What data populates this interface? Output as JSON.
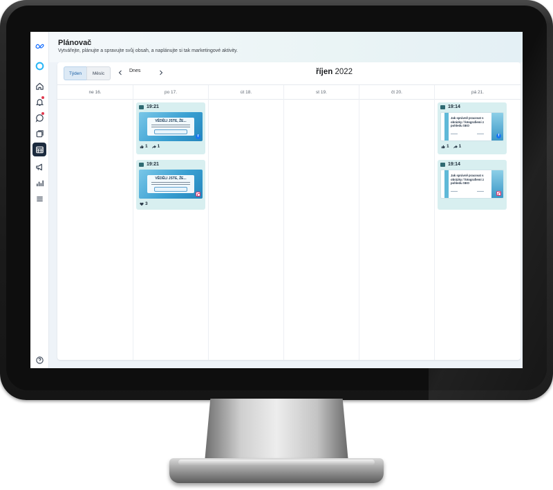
{
  "app": {
    "title": "Plánovač",
    "subtitle": "Vytvářejte, plánujte a spravujte svůj obsah, a naplánujte si tak marketingové aktivity."
  },
  "nav": {
    "items": [
      {
        "icon": "meta-logo-icon"
      },
      {
        "icon": "meta-business-suite-icon"
      },
      {
        "icon": "home-icon"
      },
      {
        "icon": "notifications-bell-icon"
      },
      {
        "icon": "inbox-icon"
      },
      {
        "icon": "content-icon"
      },
      {
        "icon": "planner-calendar-icon",
        "active": true
      },
      {
        "icon": "ads-megaphone-icon"
      },
      {
        "icon": "insights-chart-icon"
      },
      {
        "icon": "menu-icon"
      },
      {
        "icon": "help-icon"
      }
    ]
  },
  "toolbar": {
    "week_label": "Týden",
    "month_label": "Měsíc",
    "today_label": "Dnes",
    "month_name": "říjen",
    "year": "2022"
  },
  "days": [
    "ne 16.",
    "po 17.",
    "út 18.",
    "st 19.",
    "čt 20.",
    "pá 21."
  ],
  "posts": {
    "mon_fb": {
      "time": "19:21",
      "headline": "VĚDĚLI JSTE, ŽE...",
      "likes": "1",
      "shares": "1",
      "platform": "facebook"
    },
    "mon_ig": {
      "time": "19:21",
      "headline": "VĚDĚLI JSTE, ŽE...",
      "hearts": "3",
      "platform": "instagram"
    },
    "fri_fb": {
      "time": "19:14",
      "headline": "Jak správně pracovat s obrázky / fotografiemi z pohledu SEO",
      "likes": "1",
      "shares": "1",
      "platform": "facebook"
    },
    "fri_ig": {
      "time": "19:14",
      "headline": "Jak správně pracovat s obrázky / fotografiemi z pohledu SEO",
      "platform": "instagram"
    }
  },
  "colors": {
    "post_bg": "#d8eff0",
    "active_nav": "#1c2b3e",
    "facebook": "#1877f2",
    "instagram": "#d6336c"
  }
}
